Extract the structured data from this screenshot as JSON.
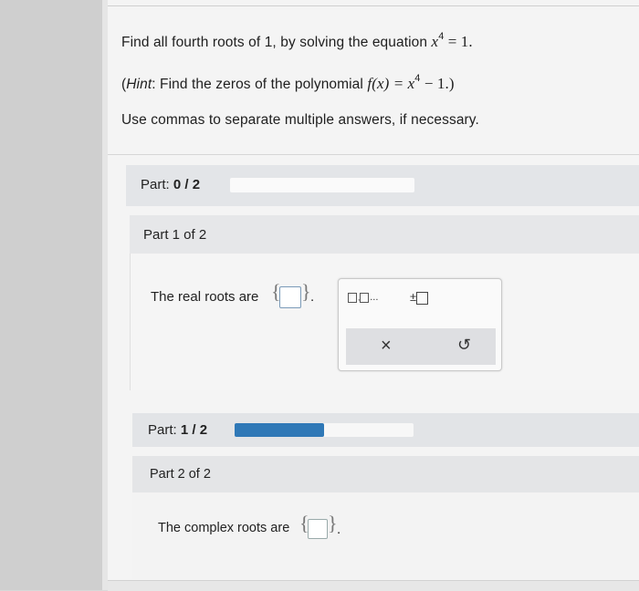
{
  "question": {
    "line1_text": "Find all fourth roots of 1, by solving the equation",
    "line1_math": "x",
    "line1_exp": "4",
    "line1_tail": " = 1.",
    "hint_prefix": "(",
    "hint_word": "Hint",
    "hint_text": ": Find the zeros of the polynomial",
    "hint_math": "f(x) = x",
    "hint_exp": "4",
    "hint_tail": " − 1.)",
    "instructions": "Use commas to separate multiple answers, if necessary."
  },
  "part_progress_1": {
    "label": "Part: ",
    "value": "0 / 2",
    "fill_fraction": 0
  },
  "part1": {
    "heading": "Part 1 of 2",
    "prompt": "The real roots are",
    "after_box": "."
  },
  "keyboard": {
    "list_button": "...",
    "plusminus_button": "±",
    "clear_icon": "×",
    "undo_icon": "↺"
  },
  "part_progress_2": {
    "label": "Part: ",
    "value": "1 / 2",
    "fill_fraction": 0.5,
    "fill_color": "#2f78b7"
  },
  "part2": {
    "heading": "Part 2 of 2",
    "prompt": "The complex roots are",
    "after_box": "."
  }
}
